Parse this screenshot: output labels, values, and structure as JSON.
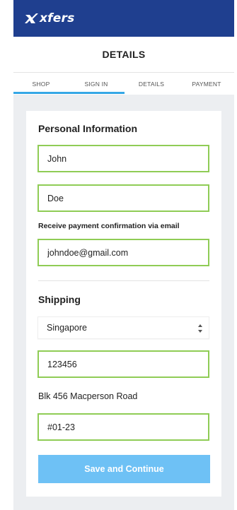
{
  "brand": {
    "logo_text": "xfers",
    "bar_color": "#1f3f8f"
  },
  "header": {
    "title": "DETAILS"
  },
  "tabs": [
    {
      "label": "SHOP"
    },
    {
      "label": "SIGN IN"
    },
    {
      "label": "DETAILS"
    },
    {
      "label": "PAYMENT"
    }
  ],
  "personal": {
    "title": "Personal Information",
    "first_name": "John",
    "last_name": "Doe",
    "email_label": "Receive payment confirmation via email",
    "email": "johndoe@gmail.com"
  },
  "shipping": {
    "title": "Shipping",
    "country": "Singapore",
    "postal_code": "123456",
    "address": "Blk 456 Macperson Road",
    "unit": "#01-23"
  },
  "actions": {
    "submit_label": "Save and Continue",
    "submit_color": "#6ec1f5"
  },
  "colors": {
    "field_border": "#8fcc55",
    "tab_indicator": "#35a7e6"
  }
}
